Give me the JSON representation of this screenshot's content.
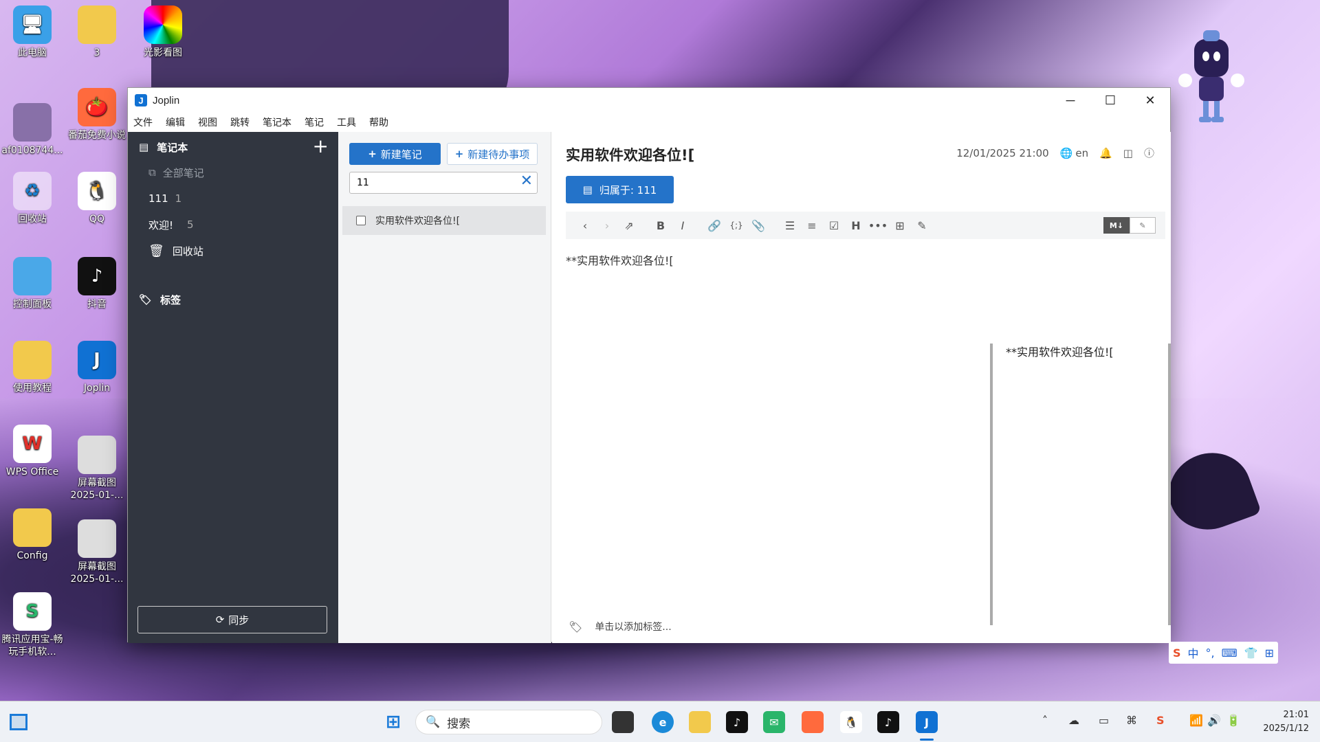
{
  "desktop": {
    "icons": [
      {
        "label": "此电脑"
      },
      {
        "label": "3"
      },
      {
        "label": "光影看图"
      },
      {
        "label": "af0108744..."
      },
      {
        "label": "番茄免费小说"
      },
      {
        "label": "回收站"
      },
      {
        "label": "QQ"
      },
      {
        "label": "控制面板"
      },
      {
        "label": "抖音"
      },
      {
        "label": "使用教程"
      },
      {
        "label": "Joplin"
      },
      {
        "label": "WPS Office"
      },
      {
        "label": "屏幕截图 2025-01-..."
      },
      {
        "label": "Config"
      },
      {
        "label": "屏幕截图 2025-01-..."
      },
      {
        "label": "腾讯应用宝-畅玩手机软..."
      }
    ]
  },
  "window": {
    "title": "Joplin",
    "controls": {
      "minimize": "─",
      "maximize": "☐",
      "close": "✕"
    }
  },
  "menu": [
    "文件",
    "编辑",
    "视图",
    "跳转",
    "笔记本",
    "笔记",
    "工具",
    "帮助"
  ],
  "sidebar": {
    "notebooks_header": "笔记本",
    "add": "+",
    "all_notes": "全部笔记",
    "notebooks": [
      {
        "name": "111",
        "count": "1"
      },
      {
        "name": "欢迎!",
        "count": "5"
      }
    ],
    "trash": "回收站",
    "tags_header": "标签",
    "sync": "同步"
  },
  "notelist": {
    "new_note": "新建笔记",
    "new_todo": "新建待办事项",
    "search_value": "11",
    "notes": [
      {
        "title": "实用软件欢迎各位!["
      }
    ]
  },
  "editor": {
    "title": "实用软件欢迎各位![",
    "date": "12/01/2025 21:00",
    "lang": "en",
    "notebook_button": "归属于: 111",
    "markdown_text": "**实用软件欢迎各位![",
    "preview_text": "**实用软件欢迎各位![",
    "tag_placeholder": "单击以添加标签...",
    "mode_md": "M↓"
  },
  "taskbar": {
    "search_placeholder": "搜索",
    "time": "21:01",
    "date": "2025/1/12"
  },
  "ime": {
    "lang": "中"
  }
}
